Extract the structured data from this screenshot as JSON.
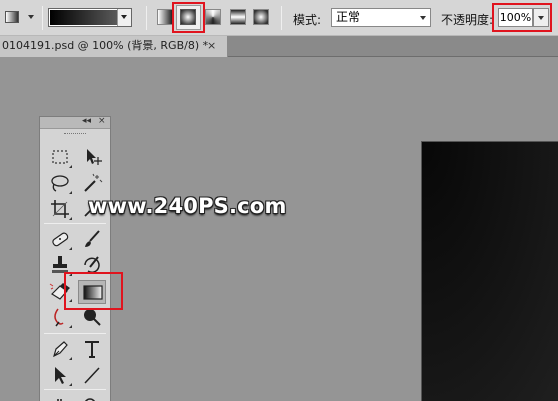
{
  "options_bar": {
    "tool_preset_icon": "gradient-tool-preset-icon",
    "gradient_picker": {
      "colors": [
        "#000000",
        "#5a5a5a"
      ]
    },
    "gradient_types": [
      {
        "name": "linear-gradient",
        "selected": false
      },
      {
        "name": "radial-gradient",
        "selected": true
      },
      {
        "name": "angle-gradient",
        "selected": false
      },
      {
        "name": "reflected-gradient",
        "selected": false
      },
      {
        "name": "diamond-gradient",
        "selected": false
      }
    ],
    "mode_label": "模式:",
    "mode_value": "正常",
    "opacity_label": "不透明度:",
    "opacity_value": "100%"
  },
  "document": {
    "tab_title": "0104191.psd @ 100% (背景, RGB/8) *",
    "close_label": "×"
  },
  "tools_panel": {
    "collapse_label": "◂◂",
    "close_label": "×",
    "tools": [
      "rectangular-marquee-icon",
      "move-icon",
      "lasso-icon",
      "magic-wand-icon",
      "crop-icon",
      "eyedropper-icon",
      "healing-brush-icon",
      "brush-icon",
      "clone-stamp-icon",
      "history-brush-icon",
      "eraser-icon",
      "gradient-icon",
      "blur-icon",
      "dodge-icon",
      "pen-icon",
      "type-icon",
      "path-selection-icon",
      "line-icon",
      "hand-icon",
      "zoom-icon"
    ],
    "selected_tool": "gradient-icon"
  },
  "watermark": "www.240PS.com",
  "colors": {
    "highlight": "#e0141e",
    "workspace": "#959595",
    "canvas": "#0a0a0a"
  }
}
